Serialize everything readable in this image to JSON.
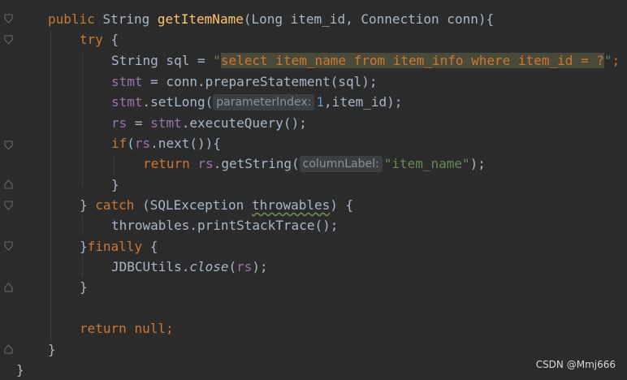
{
  "editor": {
    "l1": {
      "k1": "public",
      "t1": "String",
      "fn": "getItemName",
      "p1": "(Long item_id,",
      "p2": "Connection conn){"
    },
    "l2": {
      "k": "try",
      "b": "{"
    },
    "l3": {
      "a": "String sql = ",
      "q1": "\"",
      "s": "select item_name from item_info where item_id = ?",
      "q2": "\"",
      "end": ";"
    },
    "l4": {
      "v": "stmt",
      "rest": " = conn.prepareStatement(sql);"
    },
    "l5": {
      "v": "stmt",
      "m": ".setLong(",
      "hint": "parameterIndex:",
      "n": "1",
      "rest": ",item_id);"
    },
    "l6": {
      "v": "rs",
      "mid": " = ",
      "v2": "stmt",
      "rest": ".executeQuery();"
    },
    "l7": {
      "k": "if",
      "a": "(",
      "v": "rs",
      "rest": ".next()){"
    },
    "l8": {
      "k": "return",
      "v": "rs",
      "m": ".getString(",
      "hint": "columnLabel:",
      "s": "\"item_name\"",
      "end": ");"
    },
    "l9": {
      "b": "}"
    },
    "l10": {
      "a": "} ",
      "k": "catch",
      "b": " (SQLException ",
      "u": "throwables",
      "c": ") {"
    },
    "l11": {
      "t": "throwables.printStackTrace();"
    },
    "l12": {
      "a": "}",
      "k": "finally",
      "b": " {"
    },
    "l13": {
      "a": "JDBCUtils.",
      "it": "close",
      "b": "(",
      "v": "rs",
      "c": ");"
    },
    "l14": {
      "b": "}"
    },
    "l16": {
      "k1": "return",
      "k2": "null",
      "end": ";"
    },
    "l17": {
      "b": "}"
    },
    "l18": {
      "b": "}"
    }
  },
  "watermark": "CSDN @Mmj666"
}
